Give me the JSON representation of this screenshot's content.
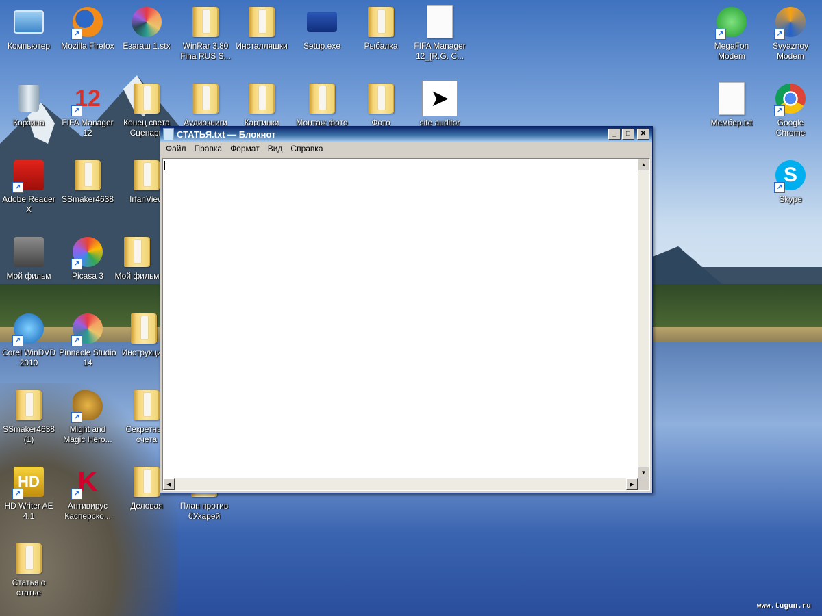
{
  "desktop": {
    "watermark": "www.tugun.ru",
    "icons": [
      {
        "label": "Компьютер",
        "icon": "computer-icon"
      },
      {
        "label": "Mozilla Firefox",
        "icon": "firefox-icon"
      },
      {
        "label": "Езагаш 1.stx",
        "icon": "pinwheel-icon"
      },
      {
        "label": "WinRar 3.80 Fina RUS S...",
        "icon": "folder-icon"
      },
      {
        "label": "Инсталляшки",
        "icon": "folder-icon"
      },
      {
        "label": "Setup.exe",
        "icon": "walkman-icon"
      },
      {
        "label": "Рыбалка",
        "icon": "folder-icon"
      },
      {
        "label": "FIFA Manager 12_[R.G. C...",
        "icon": "file-icon"
      },
      {
        "label": "MegaFon Modem",
        "icon": "megafon-icon"
      },
      {
        "label": "Svyaznoy Modem",
        "icon": "svyaznoy-icon"
      },
      {
        "label": "Корзина",
        "icon": "recycle-bin-icon"
      },
      {
        "label": "FIFA Manager 12",
        "icon": "fifa-icon"
      },
      {
        "label": "Конец света Сценари",
        "icon": "folder-icon"
      },
      {
        "label": "Аудиокниги",
        "icon": "folder-icon"
      },
      {
        "label": "Картинки",
        "icon": "folder-icon"
      },
      {
        "label": "Монтаж фото",
        "icon": "folder-icon"
      },
      {
        "label": "Фото",
        "icon": "folder-icon"
      },
      {
        "label": "site auditor",
        "icon": "cursor-icon"
      },
      {
        "label": "Мембер.txt",
        "icon": "text-file-icon"
      },
      {
        "label": "Google Chrome",
        "icon": "chrome-icon"
      },
      {
        "label": "Adobe Reader X",
        "icon": "adobe-reader-icon"
      },
      {
        "label": "SSmaker4638",
        "icon": "folder-icon"
      },
      {
        "label": "IrfanView",
        "icon": "folder-icon"
      },
      {
        "label": "Skype",
        "icon": "skype-icon"
      },
      {
        "label": "Мой фильм",
        "icon": "film-icon"
      },
      {
        "label": "Picasa 3",
        "icon": "picasa-icon"
      },
      {
        "label": "Мой фильм",
        "icon": "folder-icon"
      },
      {
        "label": "Corel WinDVD 2010",
        "icon": "windvd-icon"
      },
      {
        "label": "Pinnacle Studio 14",
        "icon": "pinnacle-icon"
      },
      {
        "label": "Инструкции",
        "icon": "folder-icon"
      },
      {
        "label": "SSmaker4638 (1)",
        "icon": "folder-icon"
      },
      {
        "label": "Might and Magic Hero...",
        "icon": "griffin-icon"
      },
      {
        "label": "Секретные счета",
        "icon": "folder-icon"
      },
      {
        "label": "HD Writer AE 4.1",
        "icon": "hd-writer-icon"
      },
      {
        "label": "Антивирус Касперско...",
        "icon": "kaspersky-icon"
      },
      {
        "label": "Деловая",
        "icon": "folder-icon"
      },
      {
        "label": "План против бУхарей",
        "icon": "folder-icon"
      },
      {
        "label": "Статья о статье",
        "icon": "folder-icon"
      }
    ]
  },
  "notepad": {
    "title": "СТАТЬЯ.txt — Блокнот",
    "controls": {
      "minimize": "_",
      "maximize": "□",
      "close": "✕"
    },
    "menu": [
      "Файл",
      "Правка",
      "Формат",
      "Вид",
      "Справка"
    ],
    "content": ""
  }
}
